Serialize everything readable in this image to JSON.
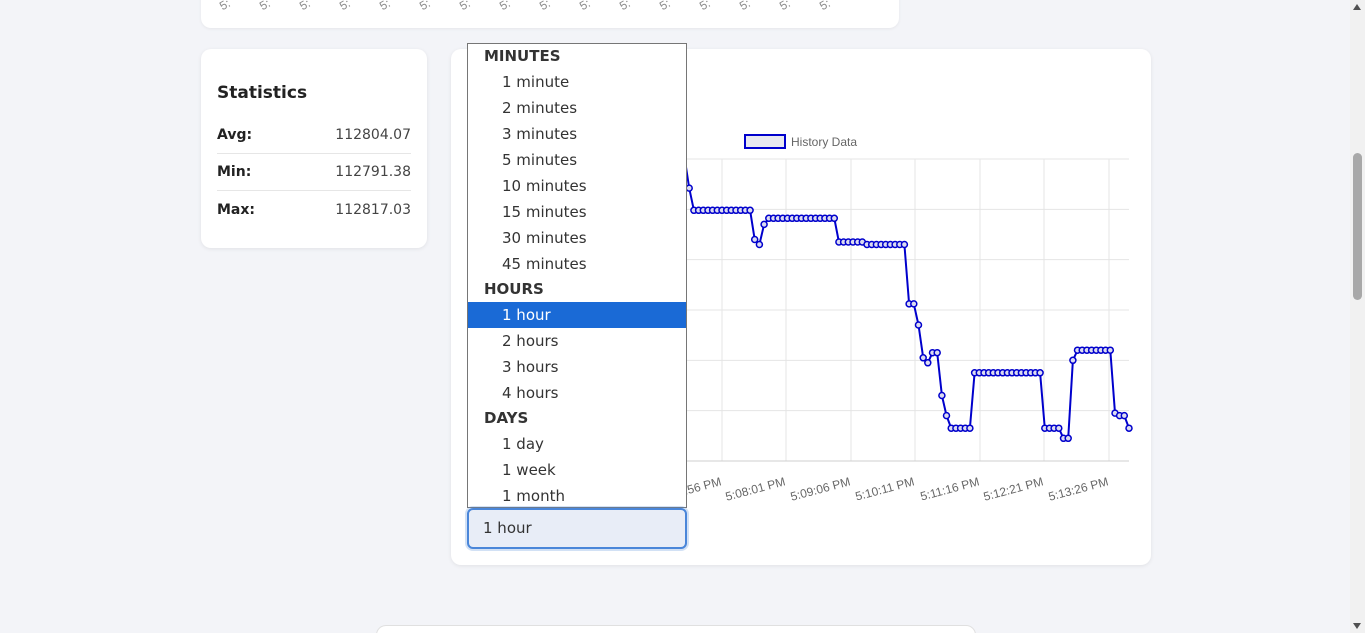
{
  "top_card": {
    "tick_labels": [
      "5:",
      "5:",
      "5:",
      "5:",
      "5:",
      "5:",
      "5:",
      "5:",
      "5:",
      "5:",
      "5:",
      "5:",
      "5:",
      "5:",
      "5:",
      "5:"
    ]
  },
  "statistics": {
    "title": "Statistics",
    "rows": [
      {
        "label": "Avg:",
        "value": "112804.07"
      },
      {
        "label": "Min:",
        "value": "112791.38"
      },
      {
        "label": "Max:",
        "value": "112817.03"
      }
    ]
  },
  "dropdown": {
    "groups": [
      {
        "label": "MINUTES",
        "options": [
          "1 minute",
          "2 minutes",
          "3 minutes",
          "5 minutes",
          "10 minutes",
          "15 minutes",
          "30 minutes",
          "45 minutes"
        ]
      },
      {
        "label": "HOURS",
        "options": [
          "1 hour",
          "2 hours",
          "3 hours",
          "4 hours"
        ]
      },
      {
        "label": "DAYS",
        "options": [
          "1 day",
          "1 week",
          "1 month"
        ]
      }
    ],
    "selected": "1 hour"
  },
  "select": {
    "value": "1 hour"
  },
  "colors": {
    "series": "#0000cc",
    "selected_option": "#1a6ad6",
    "focus_border": "#4a86d9"
  },
  "chart_data": {
    "type": "line",
    "legend": [
      "History Data"
    ],
    "legend_placement": "top",
    "grid": true,
    "x_tick_labels": [
      "5:06:56 PM",
      "5:08:01 PM",
      "5:09:06 PM",
      "5:10:11 PM",
      "5:11:16 PM",
      "5:12:21 PM",
      "5:13:26 PM"
    ],
    "x_tick_labels_visible": [
      ":56 PM",
      "5:08:01 PM",
      "5:09:06 PM",
      "5:10:11 PM",
      "5:11:16 PM",
      "5:12:21 PM",
      "5:13:26 PM"
    ],
    "series": [
      {
        "name": "History Data",
        "values": [
          0.0,
          0.0,
          0.0,
          0.0,
          0.0,
          0.0,
          -0.22,
          0.22,
          0.22,
          0.22,
          0.22,
          0.22,
          0.22,
          0.22,
          0.22,
          0.22,
          0.22,
          0.22,
          0.22,
          0.22,
          0.22,
          -0.38,
          -0.82,
          -0.82,
          -0.82,
          -0.82,
          -0.82,
          -0.82,
          -0.82,
          -0.82,
          -0.82,
          -0.82,
          -0.82,
          -0.82,
          -0.82,
          -1.4,
          -1.5,
          -1.1,
          -0.98,
          -0.98,
          -0.98,
          -0.98,
          -0.98,
          -0.98,
          -0.98,
          -0.98,
          -0.98,
          -0.98,
          -0.98,
          -0.98,
          -0.98,
          -0.98,
          -0.98,
          -1.45,
          -1.45,
          -1.45,
          -1.45,
          -1.45,
          -1.45,
          -1.5,
          -1.5,
          -1.5,
          -1.5,
          -1.5,
          -1.5,
          -1.5,
          -1.5,
          -1.5,
          -2.68,
          -2.68,
          -3.1,
          -3.75,
          -3.85,
          -3.65,
          -3.65,
          -4.5,
          -4.9,
          -5.15,
          -5.15,
          -5.15,
          -5.15,
          -5.15,
          -4.05,
          -4.05,
          -4.05,
          -4.05,
          -4.05,
          -4.05,
          -4.05,
          -4.05,
          -4.05,
          -4.05,
          -4.05,
          -4.05,
          -4.05,
          -4.05,
          -4.05,
          -5.15,
          -5.15,
          -5.15,
          -5.15,
          -5.35,
          -5.35,
          -3.8,
          -3.6,
          -3.6,
          -3.6,
          -3.6,
          -3.6,
          -3.6,
          -3.6,
          -3.6,
          -4.85,
          -4.9,
          -4.9,
          -5.15
        ]
      }
    ],
    "ylim": [
      -6.0,
      0.0
    ]
  }
}
